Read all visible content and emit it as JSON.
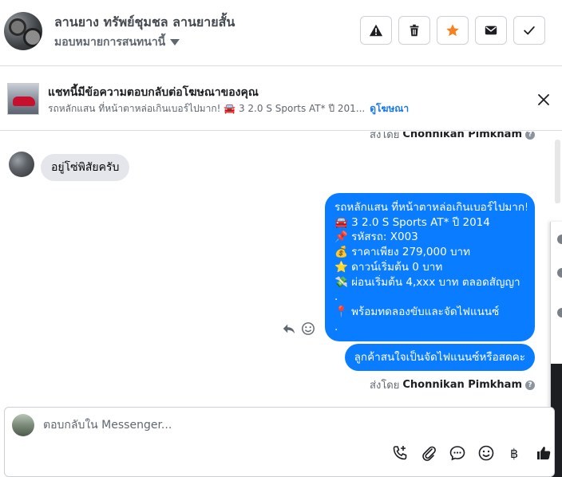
{
  "header": {
    "title": "ลานยาง ทรัพย์ชุมชล ลานยายสั้น",
    "assign_label": "มอบหมายการสนทนานี้",
    "buttons": {
      "spam": "report-icon",
      "delete": "trash-icon",
      "star": "star-icon",
      "mark_unread": "envelope-icon",
      "done": "checkmark-icon"
    },
    "star_color": "#f5821f"
  },
  "ad": {
    "title": "แชทนี้มีข้อความตอบกลับต่อโฆษณาของคุณ",
    "summary": "รถหลักแสน ที่หน้าตาหล่อเกินเบอร์ไปมาก! 🚘 3 2.0 S Sports AT* ปี 201...",
    "link": "ดูโฆษณา"
  },
  "thread": {
    "sent_by_prefix": "ส่งโดย",
    "sent_by_name": "Chonnikan Pimkham",
    "incoming": "อยู่โซ่พิสัยครับ",
    "outgoing_main": [
      "รถหลักแสน ที่หน้าตาหล่อเกินเบอร์ไปมาก!",
      "🚘 3 2.0 S Sports AT* ปี 2014",
      "📌 รหัสรถ: X003",
      "💰 ราคาเพียง 279,000 บาท",
      "⭐ ดาวน์เริ่มต้น 0 บาท",
      "💸 ผ่อนเริ่มต้น 4,xxx บาท ตลอดสัญญา",
      ".",
      "📍 พร้อมทดลองขับและจัดไฟแนนซ์",
      "."
    ],
    "outgoing_small": "ลูกค้าสนใจเป็นจัดไฟแนนซ์หรือสดคะ",
    "bubble_color": "#0a7cff"
  },
  "composer": {
    "placeholder": "ตอบกลับใน Messenger...",
    "tools": [
      "call-add-icon",
      "paperclip-icon",
      "chat-bubble-icon",
      "emoji-icon",
      "baht-icon",
      "thumbs-up-icon"
    ]
  }
}
